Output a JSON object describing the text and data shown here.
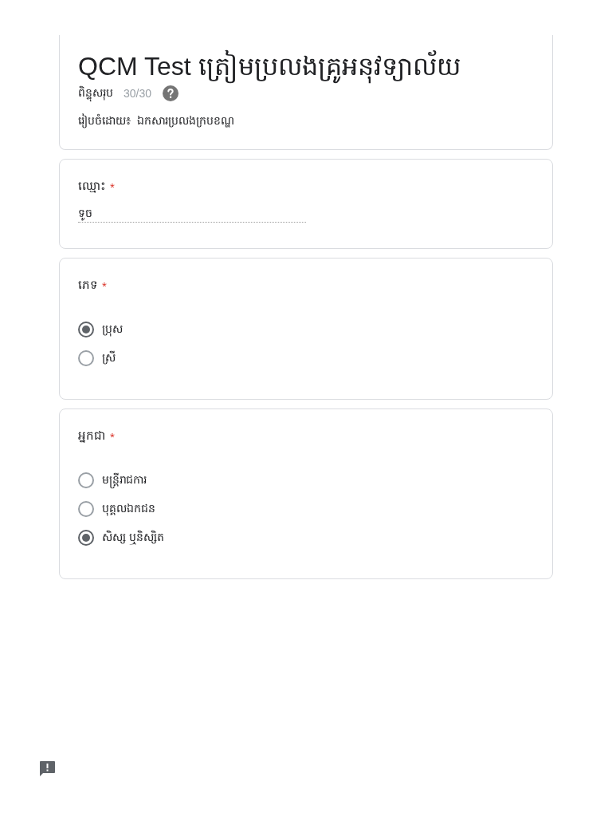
{
  "header": {
    "title": "QCM Test ត្រៀមប្រលងគ្រូអនុវទ្យាល័យ",
    "score_label": "ពិន្ទុសរុប",
    "score": "30/30",
    "prepared_by": "រៀបចំដោយ៖  ឯកសារប្រលងក្របខណ្ឌ"
  },
  "questions": [
    {
      "kind": "text",
      "label": "ឈ្មោះ",
      "required_mark": "*",
      "value": "ទូច"
    },
    {
      "kind": "choice",
      "label": "ភេទ",
      "required_mark": "*",
      "options": [
        {
          "label": "ប្រុស",
          "selected": true
        },
        {
          "label": "ស្រី",
          "selected": false
        }
      ]
    },
    {
      "kind": "choice",
      "label": "អ្នកជា",
      "required_mark": "*",
      "options": [
        {
          "label": "មន្ត្រីរាជការ",
          "selected": false
        },
        {
          "label": "បុគ្គលឯកជន",
          "selected": false
        },
        {
          "label": "សិស្ស ឬនិស្សិត",
          "selected": true
        }
      ]
    }
  ]
}
